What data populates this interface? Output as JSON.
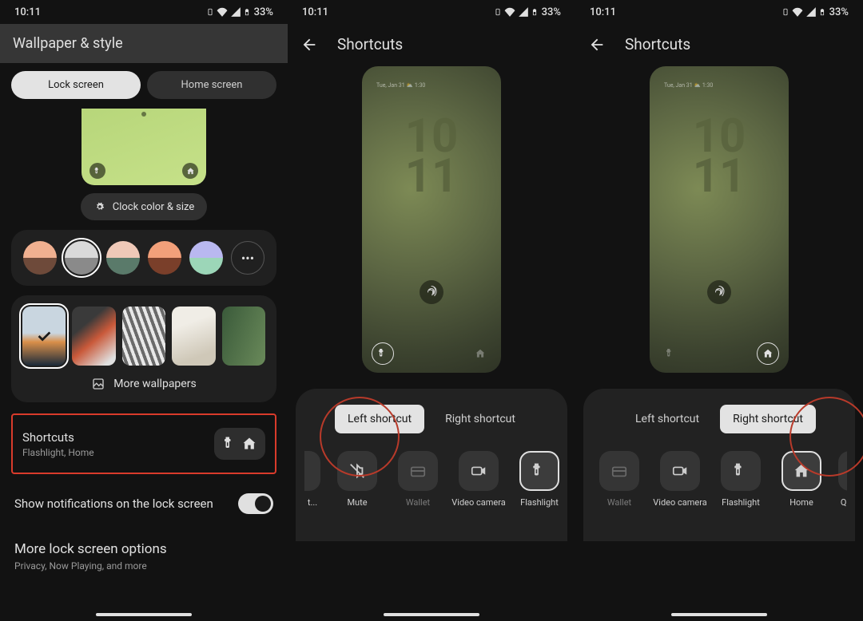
{
  "status": {
    "time": "10:11",
    "battery": "33%"
  },
  "phone1": {
    "title": "Wallpaper & style",
    "tabs": {
      "lock": "Lock screen",
      "home": "Home screen"
    },
    "clock_chip": "Clock color & size",
    "more_wallpapers": "More wallpapers",
    "shortcuts": {
      "title": "Shortcuts",
      "subtitle": "Flashlight, Home"
    },
    "notifications_label": "Show notifications on the lock screen",
    "more_options": {
      "title": "More lock screen options",
      "subtitle": "Privacy, Now Playing, and more"
    }
  },
  "phone2": {
    "title": "Shortcuts",
    "tabs": {
      "left": "Left shortcut",
      "right": "Right shortcut"
    },
    "clock": {
      "h": "10",
      "m": "11"
    },
    "date_tiny": "Tue, Jan 31  ⛅ 1:30",
    "options": [
      {
        "key": "t",
        "label": "t..."
      },
      {
        "key": "mute",
        "label": "Mute"
      },
      {
        "key": "wallet",
        "label": "Wallet"
      },
      {
        "key": "video",
        "label": "Video camera"
      },
      {
        "key": "flash",
        "label": "Flashlight"
      }
    ]
  },
  "phone3": {
    "title": "Shortcuts",
    "tabs": {
      "left": "Left shortcut",
      "right": "Right shortcut"
    },
    "clock": {
      "h": "10",
      "m": "11"
    },
    "date_tiny": "Tue, Jan 31  ⛅ 1:30",
    "options": [
      {
        "key": "wallet",
        "label": "Wallet"
      },
      {
        "key": "video",
        "label": "Video camera"
      },
      {
        "key": "flash",
        "label": "Flashlight"
      },
      {
        "key": "home",
        "label": "Home"
      },
      {
        "key": "qr",
        "label": "QR"
      }
    ]
  }
}
